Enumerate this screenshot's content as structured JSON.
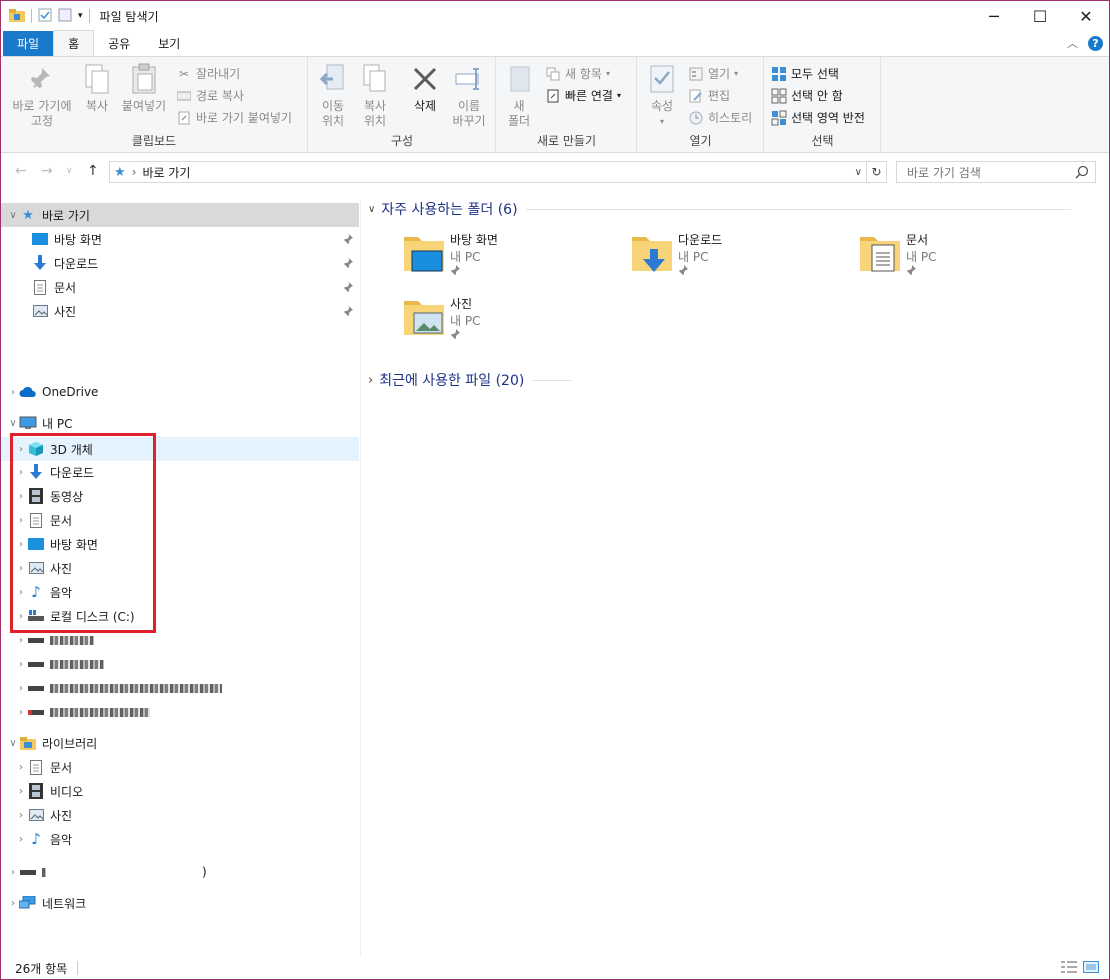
{
  "window": {
    "title": "파일 탐색기",
    "minimize": "─",
    "maximize": "☐",
    "close": "✕"
  },
  "tabs": [
    "파일",
    "홈",
    "공유",
    "보기"
  ],
  "ribbon": {
    "clipboard": {
      "label": "클립보드",
      "pin": "바로 가기에\n고정",
      "copy": "복사",
      "paste": "붙여넣기",
      "cut": "잘라내기",
      "copy_path": "경로 복사",
      "paste_shortcut": "바로 가기 붙여넣기"
    },
    "organize": {
      "label": "구성",
      "move": "이동\n위치",
      "copy_to": "복사\n위치",
      "delete": "삭제",
      "rename": "이름\n바꾸기"
    },
    "new": {
      "label": "새로 만들기",
      "new_folder": "새\n폴더",
      "new_item": "새 항목",
      "easy_access": "빠른 연결"
    },
    "open": {
      "label": "열기",
      "properties": "속성",
      "open": "열기",
      "edit": "편집",
      "history": "히스토리"
    },
    "select": {
      "label": "선택",
      "select_all": "모두 선택",
      "select_none": "선택 안 함",
      "invert": "선택 영역 반전"
    }
  },
  "address": {
    "path": "바로 가기",
    "search_placeholder": "바로 가기 검색"
  },
  "nav": {
    "quick_access": "바로 가기",
    "qa_items": [
      "바탕 화면",
      "다운로드",
      "문서",
      "사진"
    ],
    "onedrive": "OneDrive",
    "this_pc": "내 PC",
    "pc_items": [
      "3D 개체",
      "다운로드",
      "동영상",
      "문서",
      "바탕 화면",
      "사진",
      "음악",
      "로컬 디스크 (C:)"
    ],
    "libraries": "라이브러리",
    "lib_items": [
      "문서",
      "비디오",
      "사진",
      "음악"
    ],
    "blurred_drive_suffix": ")",
    "network": "네트워크"
  },
  "content": {
    "frequent": "자주 사용하는 폴더 (6)",
    "recent": "최근에 사용한 파일 (20)",
    "folders": [
      {
        "name": "바탕 화면",
        "location": "내 PC"
      },
      {
        "name": "다운로드",
        "location": "내 PC"
      },
      {
        "name": "문서",
        "location": "내 PC"
      },
      {
        "name": "사진",
        "location": "내 PC"
      }
    ]
  },
  "status": {
    "count": "26개 항목"
  },
  "colors": {
    "accent": "#1979ca",
    "highlight_box": "#e0202a",
    "folder": "#f4c95d"
  }
}
